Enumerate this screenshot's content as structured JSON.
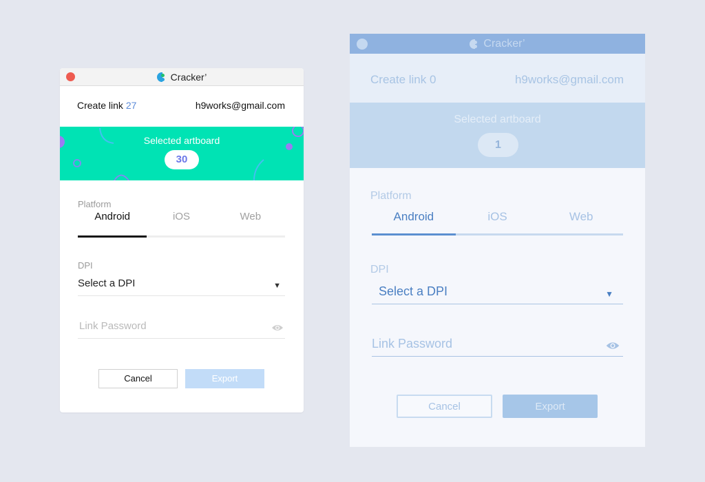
{
  "colors": {
    "background": "#e4e7ef",
    "banner_mint": "#00e3b4",
    "accent_blue": "#5b8bd8",
    "close_red": "#ee5b50",
    "export_disabled": "#c2dcf8"
  },
  "left_window": {
    "title": "Cracker’",
    "create_link_label": "Create link",
    "create_link_count": "27",
    "email": "h9works@gmail.com",
    "banner_label": "Selected artboard",
    "artboard_count": "30",
    "platform_label": "Platform",
    "tabs": [
      {
        "label": "Android",
        "active": true
      },
      {
        "label": "iOS",
        "active": false
      },
      {
        "label": "Web",
        "active": false
      }
    ],
    "dpi_label": "DPI",
    "dpi_value": "Select a DPI",
    "password_placeholder": "Link Password",
    "cancel_label": "Cancel",
    "export_label": "Export",
    "icons": {
      "logo": "app-logo-icon",
      "caret": "caret-down-icon",
      "eye": "eye-icon",
      "close": "close-dot-icon"
    }
  },
  "right_window": {
    "title": "Cracker’",
    "create_link_label": "Create link 0",
    "email": "h9works@gmail.com",
    "banner_label": "Selected artboard",
    "artboard_count": "1",
    "platform_label": "Platform",
    "tabs": [
      {
        "label": "Android",
        "active": true
      },
      {
        "label": "iOS",
        "active": false
      },
      {
        "label": "Web",
        "active": false
      }
    ],
    "dpi_label": "DPI",
    "dpi_value": "Select a DPI",
    "password_placeholder": "Link Password",
    "cancel_label": "Cancel",
    "export_label": "Export"
  }
}
